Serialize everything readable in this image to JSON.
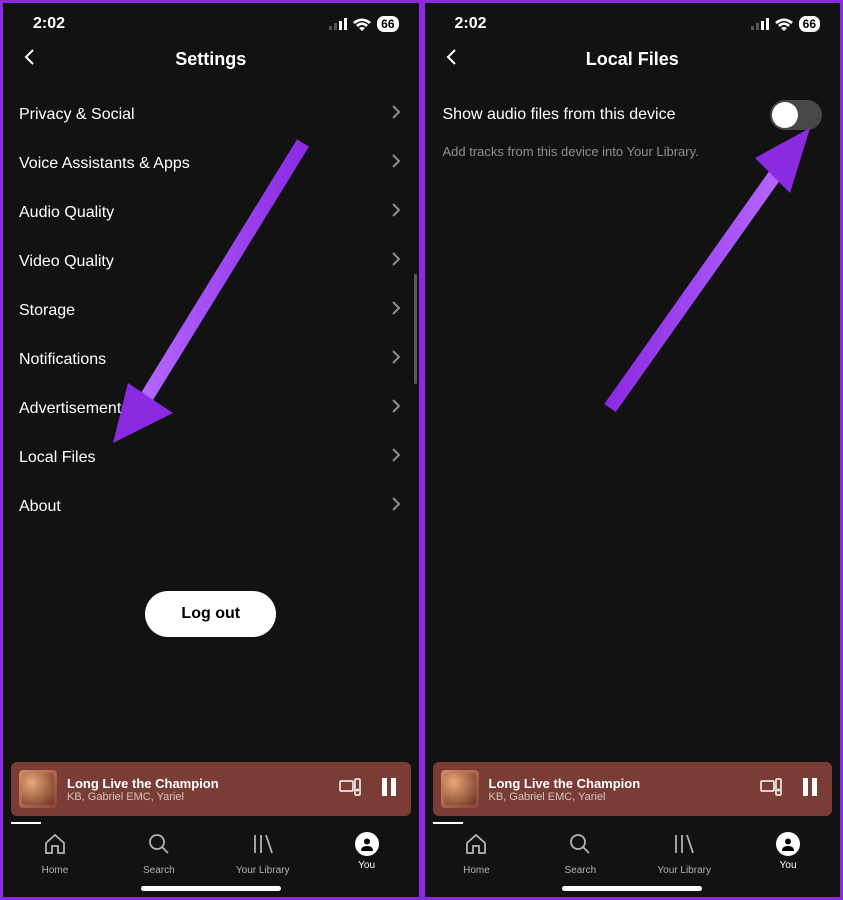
{
  "status": {
    "time": "2:02",
    "battery": "66"
  },
  "left": {
    "header_title": "Settings",
    "items": [
      "Privacy & Social",
      "Voice Assistants & Apps",
      "Audio Quality",
      "Video Quality",
      "Storage",
      "Notifications",
      "Advertisements",
      "Local Files",
      "About"
    ],
    "logout": "Log out"
  },
  "right": {
    "header_title": "Local Files",
    "toggle_label": "Show audio files from this device",
    "toggle_description": "Add tracks from this device into Your Library.",
    "toggle_on": false
  },
  "now_playing": {
    "title": "Long Live the Champion",
    "artist": "KB, Gabriel EMC, Yariel"
  },
  "nav": {
    "items": [
      {
        "label": "Home",
        "icon": "home"
      },
      {
        "label": "Search",
        "icon": "search"
      },
      {
        "label": "Your Library",
        "icon": "library"
      },
      {
        "label": "You",
        "icon": "you"
      }
    ],
    "active_index": 3
  }
}
